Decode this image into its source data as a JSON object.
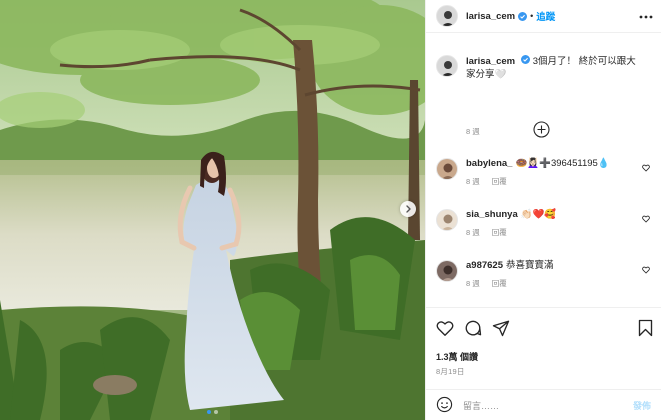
{
  "header": {
    "username": "larisa_cem",
    "separator": "•",
    "follow_label": "追蹤"
  },
  "caption": {
    "username": "larisa_cem",
    "text": "3個月了！ 終於可以跟大家分享🤍",
    "age": "8 週"
  },
  "comments": [
    {
      "username": "babylena_",
      "text": "🍩💆🏻‍♀️➕396451195💧",
      "age": "8 週",
      "reply_label": "回覆"
    },
    {
      "username": "sia_shunya",
      "text": "👏🏻❤️🥰",
      "age": "8 週",
      "reply_label": "回覆"
    },
    {
      "username": "a987625",
      "text": "恭喜寶寶滿",
      "age": "8 週",
      "reply_label": "回覆"
    }
  ],
  "stats": {
    "views": "1.3萬 個讚",
    "date": "8月19日"
  },
  "comment_input": {
    "placeholder": "留言……",
    "post_label": "發佈"
  },
  "carousel": {
    "slide_count": 2,
    "active_index": 0
  },
  "colors": {
    "accent": "#0095f6",
    "verified": "#3897f0",
    "muted": "#8e8e8e"
  },
  "icons": [
    "verified-badge-icon",
    "more-options-icon",
    "load-more-icon",
    "heart-icon",
    "comment-icon",
    "share-icon",
    "bookmark-icon",
    "emoji-icon",
    "chevron-right-icon"
  ]
}
